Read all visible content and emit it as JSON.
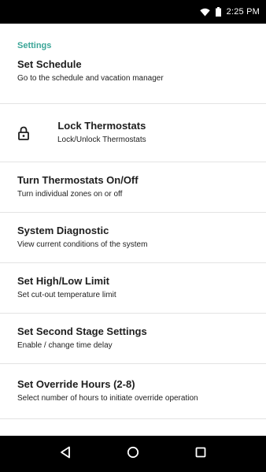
{
  "status_bar": {
    "time": "2:25 PM",
    "icons": [
      "wifi-icon",
      "battery-icon"
    ]
  },
  "header": {
    "section_label": "Settings"
  },
  "settings": {
    "items": [
      {
        "title": "Set Schedule",
        "subtitle": "Go to the schedule and vacation manager"
      },
      {
        "title": "Lock Thermostats",
        "subtitle": "Lock/Unlock Thermostats",
        "icon": "lock-icon"
      },
      {
        "title": "Turn Thermostats On/Off",
        "subtitle": "Turn individual zones on or off"
      },
      {
        "title": "System Diagnostic",
        "subtitle": "View current conditions of the system"
      },
      {
        "title": "Set High/Low Limit",
        "subtitle": "Set cut-out temperature limit"
      },
      {
        "title": "Set Second Stage Settings",
        "subtitle": "Enable / change time delay"
      },
      {
        "title": "Set Override Hours (2-8)",
        "subtitle": "Select number of hours to initiate override operation"
      }
    ]
  },
  "nav_bar": {
    "buttons": [
      "back-icon",
      "home-icon",
      "recents-icon"
    ]
  },
  "colors": {
    "accent": "#3aa597",
    "bars": "#000000",
    "divider": "#e3e3e3"
  }
}
